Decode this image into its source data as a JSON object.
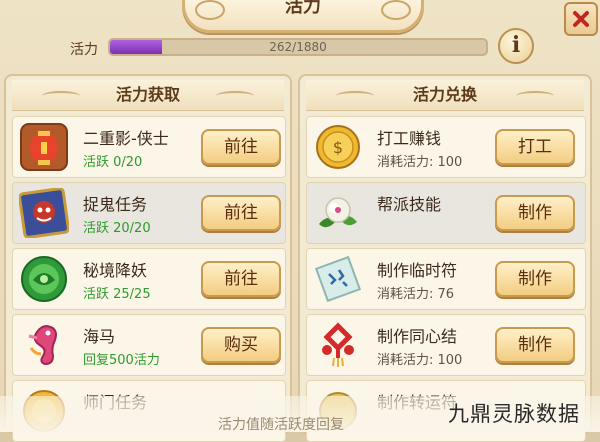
{
  "header": {
    "title": "活力"
  },
  "vitality": {
    "label": "活力",
    "current": 262,
    "max": 1880,
    "text": "262/1880",
    "fraction": 0.139
  },
  "left_panel": {
    "title": "活力获取",
    "rows": [
      {
        "title": "二重影-侠士",
        "sub": "活跃  0/20",
        "button": "前往",
        "icon": "lantern-icon"
      },
      {
        "title": "捉鬼任务",
        "sub": "活跃  20/20",
        "button": "前往",
        "icon": "ghost-scroll-icon"
      },
      {
        "title": "秘境降妖",
        "sub": "活跃  25/25",
        "button": "前往",
        "icon": "jade-disc-icon"
      },
      {
        "title": "海马",
        "sub": "回复500活力",
        "button": "购买",
        "icon": "seahorse-icon"
      },
      {
        "title": "师门任务",
        "sub": "",
        "button": "",
        "icon": "medal-icon"
      }
    ]
  },
  "right_panel": {
    "title": "活力兑换",
    "rows": [
      {
        "title": "打工赚钱",
        "sub": "消耗活力: 100",
        "button": "打工",
        "icon": "gold-coin-icon"
      },
      {
        "title": "帮派技能",
        "sub": "",
        "button": "制作",
        "icon": "flower-icon"
      },
      {
        "title": "制作临时符",
        "sub": "消耗活力: 76",
        "button": "制作",
        "icon": "talisman-icon"
      },
      {
        "title": "制作同心结",
        "sub": "消耗活力: 100",
        "button": "制作",
        "icon": "chinese-knot-icon"
      },
      {
        "title": "制作转运符",
        "sub": "",
        "button": "",
        "icon": "lucky-charm-icon"
      }
    ]
  },
  "footer": {
    "note": "活力值随活跃度回复"
  },
  "watermark": "九鼎灵脉数据",
  "colors": {
    "accent_purple": "#8e3fc4",
    "active_green": "#2e9a2c",
    "button_gold": "#f3cd82"
  }
}
